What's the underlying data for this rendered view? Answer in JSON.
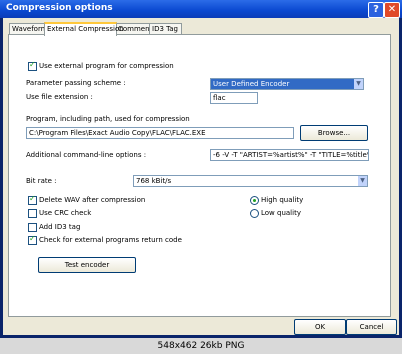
{
  "window": {
    "title": "Compression options",
    "help_label": "?",
    "close_label": "✕"
  },
  "tabs": [
    {
      "label": "Waveform"
    },
    {
      "label": "External Compression"
    },
    {
      "label": "Comment"
    },
    {
      "label": "ID3 Tag"
    }
  ],
  "options": {
    "use_external": {
      "label": "Use external program for compression",
      "checked": true
    },
    "param_scheme": {
      "label": "Parameter passing scheme :",
      "value": "User Defined Encoder"
    },
    "file_ext": {
      "label": "Use file extension :",
      "value": "flac"
    },
    "program_path": {
      "label": "Program, including path, used for compression",
      "value": "C:\\Program Files\\Exact Audio Copy\\FLAC\\FLAC.EXE",
      "browse_label": "Browse..."
    },
    "cmd_options": {
      "label": "Additional command-line options :",
      "value": "-6 -V -T \"ARTIST=%artist%\" -T \"TITLE=%title%\" -T \""
    },
    "bit_rate": {
      "label": "Bit rate :",
      "value": "768 kBit/s"
    },
    "delete_wav": {
      "label": "Delete WAV after compression",
      "checked": true
    },
    "use_crc": {
      "label": "Use CRC check",
      "checked": false
    },
    "add_id3": {
      "label": "Add ID3 tag",
      "checked": false
    },
    "check_return": {
      "label": "Check for external programs return code",
      "checked": true
    },
    "high_quality": {
      "label": "High quality",
      "selected": true
    },
    "low_quality": {
      "label": "Low quality",
      "selected": false
    },
    "test_encoder": "Test encoder"
  },
  "footer": {
    "ok_label": "OK",
    "cancel_label": "Cancel"
  },
  "caption": "548x462 26kb PNG",
  "colors": {
    "titlebar": "#0a48d0",
    "selection": "#316ac5",
    "dialog_bg": "#ece9d8"
  }
}
